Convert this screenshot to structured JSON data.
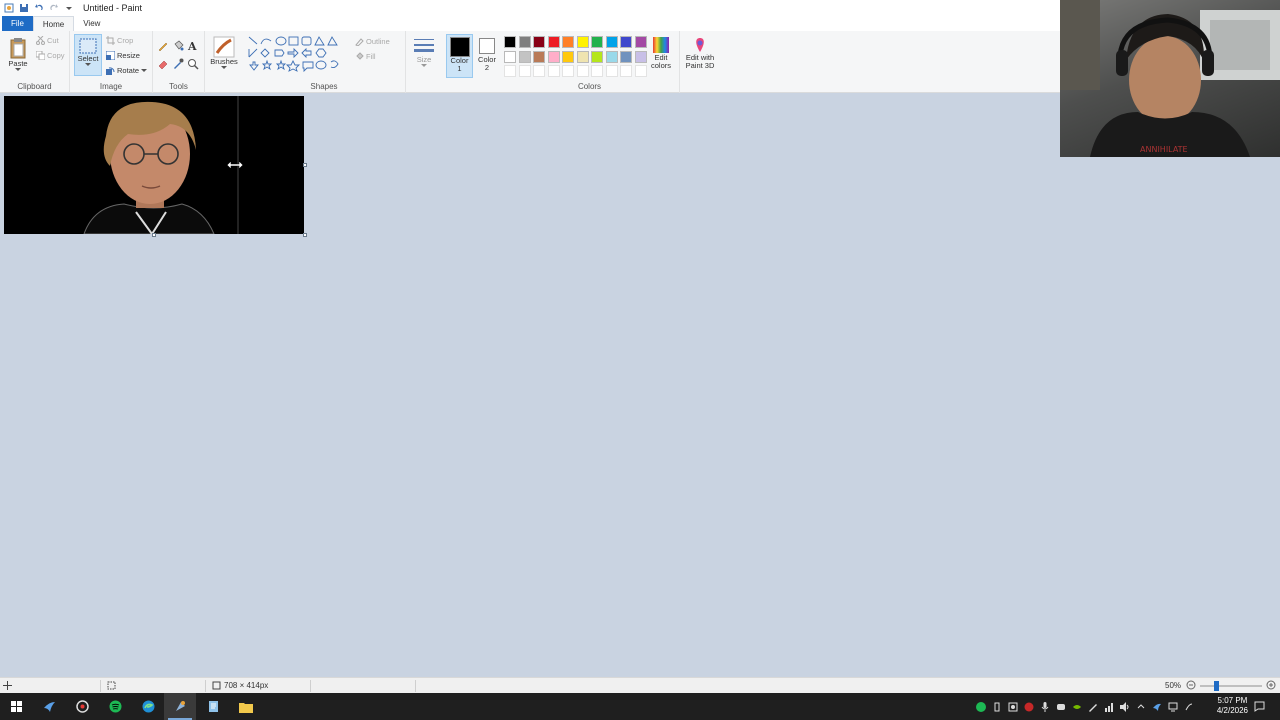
{
  "window": {
    "title": "Untitled - Paint"
  },
  "tabs": [
    "File",
    "Home",
    "View"
  ],
  "ribbon": {
    "clipboard": {
      "label": "Clipboard",
      "paste": "Paste",
      "cut": "Cut",
      "copy": "Copy"
    },
    "image": {
      "label": "Image",
      "select": "Select",
      "crop": "Crop",
      "resize": "Resize",
      "rotate": "Rotate"
    },
    "tools": {
      "label": "Tools"
    },
    "brushes": {
      "label": "Brushes"
    },
    "shapes": {
      "label": "Shapes",
      "outline": "Outline",
      "fill": "Fill"
    },
    "size": {
      "label": "Size"
    },
    "color1": {
      "label": "Color 1"
    },
    "color2": {
      "label": "Color 2"
    },
    "colors": {
      "label": "Colors",
      "edit": "Edit colors"
    },
    "paint3d": {
      "label": "Edit with Paint 3D"
    },
    "palette_row1": [
      "#000000",
      "#7f7f7f",
      "#880015",
      "#ed1c24",
      "#ff7f27",
      "#fff200",
      "#22b14c",
      "#00a2e8",
      "#3f48cc",
      "#a349a4"
    ],
    "palette_row2": [
      "#ffffff",
      "#c3c3c3",
      "#b97a57",
      "#ffaec9",
      "#ffc90e",
      "#efe4b0",
      "#b5e61d",
      "#99d9ea",
      "#7092be",
      "#c8bfe7"
    ],
    "color1_value": "#000000",
    "color2_value": "#ffffff"
  },
  "status": {
    "image_size": "708 × 414px",
    "zoom": "50%"
  },
  "taskbar": {
    "time": "5:07 PM",
    "date": "4/2/2026"
  }
}
